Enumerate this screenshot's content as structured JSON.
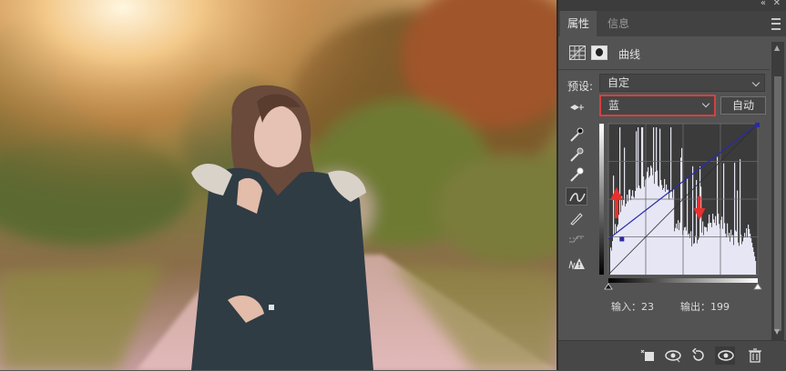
{
  "panel": {
    "tabs": [
      {
        "label": "属性",
        "active": true
      },
      {
        "label": "信息",
        "active": false
      }
    ],
    "adjustment_title": "曲线",
    "preset_label": "预设:",
    "preset_value": "自定",
    "channel_value": "蓝",
    "auto_label": "自动",
    "input_label": "输入：23",
    "output_label": "输出：199"
  },
  "curve": {
    "channel_color": "#2a2aa8",
    "point": {
      "input": 23,
      "output": 199
    },
    "annotation_color": "#e8302c"
  },
  "colors": {
    "panel_bg": "#535353",
    "highlight": "#d8403f",
    "histogram_fill": "#e6e6f5"
  },
  "icons": [
    "target-adjust-icon",
    "black-eyedropper-icon",
    "gray-eyedropper-icon",
    "white-eyedropper-icon",
    "curve-edit-icon",
    "pencil-icon",
    "smooth-icon",
    "clipping-warning-icon",
    "clip-to-layer-icon",
    "view-previous-icon",
    "reset-icon",
    "visibility-eye-icon",
    "trash-icon"
  ]
}
